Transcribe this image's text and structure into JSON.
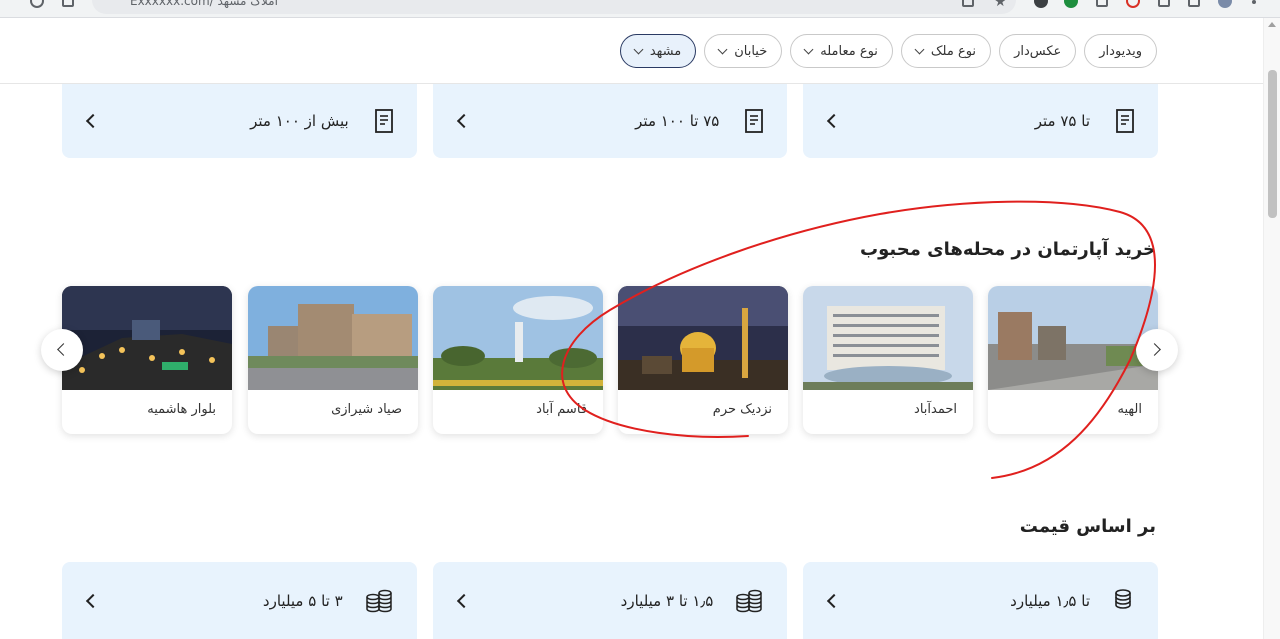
{
  "browser": {
    "address_text": "Exxxxxx.com/ املاک مشهد"
  },
  "filters": {
    "chips": [
      {
        "label": "مشهد",
        "dropdown": true,
        "active": true
      },
      {
        "label": "خیابان",
        "dropdown": true,
        "active": false
      },
      {
        "label": "نوع معامله",
        "dropdown": true,
        "active": false
      },
      {
        "label": "نوع ملک",
        "dropdown": true,
        "active": false
      },
      {
        "label": "عکس‌دار",
        "dropdown": false,
        "active": false
      },
      {
        "label": "ویدیودار",
        "dropdown": false,
        "active": false
      }
    ]
  },
  "area_cards": [
    {
      "label": "تا ۷۵ متر",
      "icon": "document-icon"
    },
    {
      "label": "۷۵ تا ۱۰۰ متر",
      "icon": "document-icon"
    },
    {
      "label": "بیش از ۱۰۰ متر",
      "icon": "document-icon"
    }
  ],
  "neighborhoods": {
    "title": "خرید آپارتمان در محله‌های محبوب",
    "items": [
      {
        "name": "الهیه"
      },
      {
        "name": "احمدآباد"
      },
      {
        "name": "نزدیک حرم"
      },
      {
        "name": "قاسم آباد"
      },
      {
        "name": "صیاد شیرازی"
      },
      {
        "name": "بلوار هاشمیه"
      }
    ]
  },
  "price": {
    "title": "بر اساس قیمت",
    "cards": [
      {
        "label": "تا ۱٫۵ میلیارد",
        "icon": "coins-icon"
      },
      {
        "label": "۱٫۵ تا ۳ میلیارد",
        "icon": "coins-icon"
      },
      {
        "label": "۳ تا ۵ میلیارد",
        "icon": "coins-icon"
      }
    ]
  },
  "colors": {
    "tile_bg": "#e8f3fd",
    "active_chip_border": "#2a3a63",
    "annotation": "#e0201e"
  }
}
